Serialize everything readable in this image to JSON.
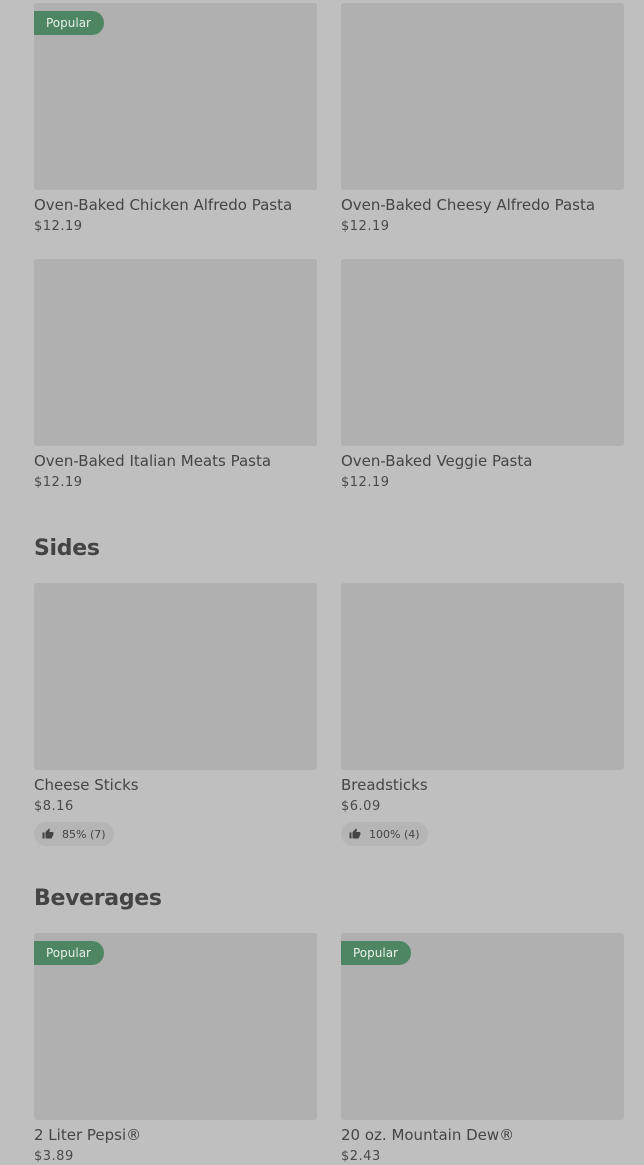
{
  "pasta": {
    "items": [
      {
        "name": "Oven-Baked Chicken Alfredo Pasta",
        "price": "$12.19",
        "badge": "Popular"
      },
      {
        "name": "Oven-Baked Cheesy Alfredo Pasta",
        "price": "$12.19"
      },
      {
        "name": "Oven-Baked Italian Meats Pasta",
        "price": "$12.19"
      },
      {
        "name": "Oven-Baked Veggie Pasta",
        "price": "$12.19"
      }
    ]
  },
  "sides": {
    "title": "Sides",
    "items": [
      {
        "name": "Cheese Sticks",
        "price": "$8.16",
        "rating": "85% (7)",
        "icon": "thumbs-up-icon"
      },
      {
        "name": "Breadsticks",
        "price": "$6.09",
        "rating": "100% (4)",
        "icon": "thumbs-up-icon"
      }
    ]
  },
  "beverages": {
    "title": "Beverages",
    "items": [
      {
        "name": "2 Liter Pepsi®",
        "price": "$3.89",
        "badge": "Popular"
      },
      {
        "name": "20 oz. Mountain Dew®",
        "price": "$2.43",
        "badge": "Popular"
      }
    ]
  },
  "colors": {
    "background": "#bfbfbf",
    "image_placeholder": "#b0b0b0",
    "badge": "#4e8663"
  }
}
